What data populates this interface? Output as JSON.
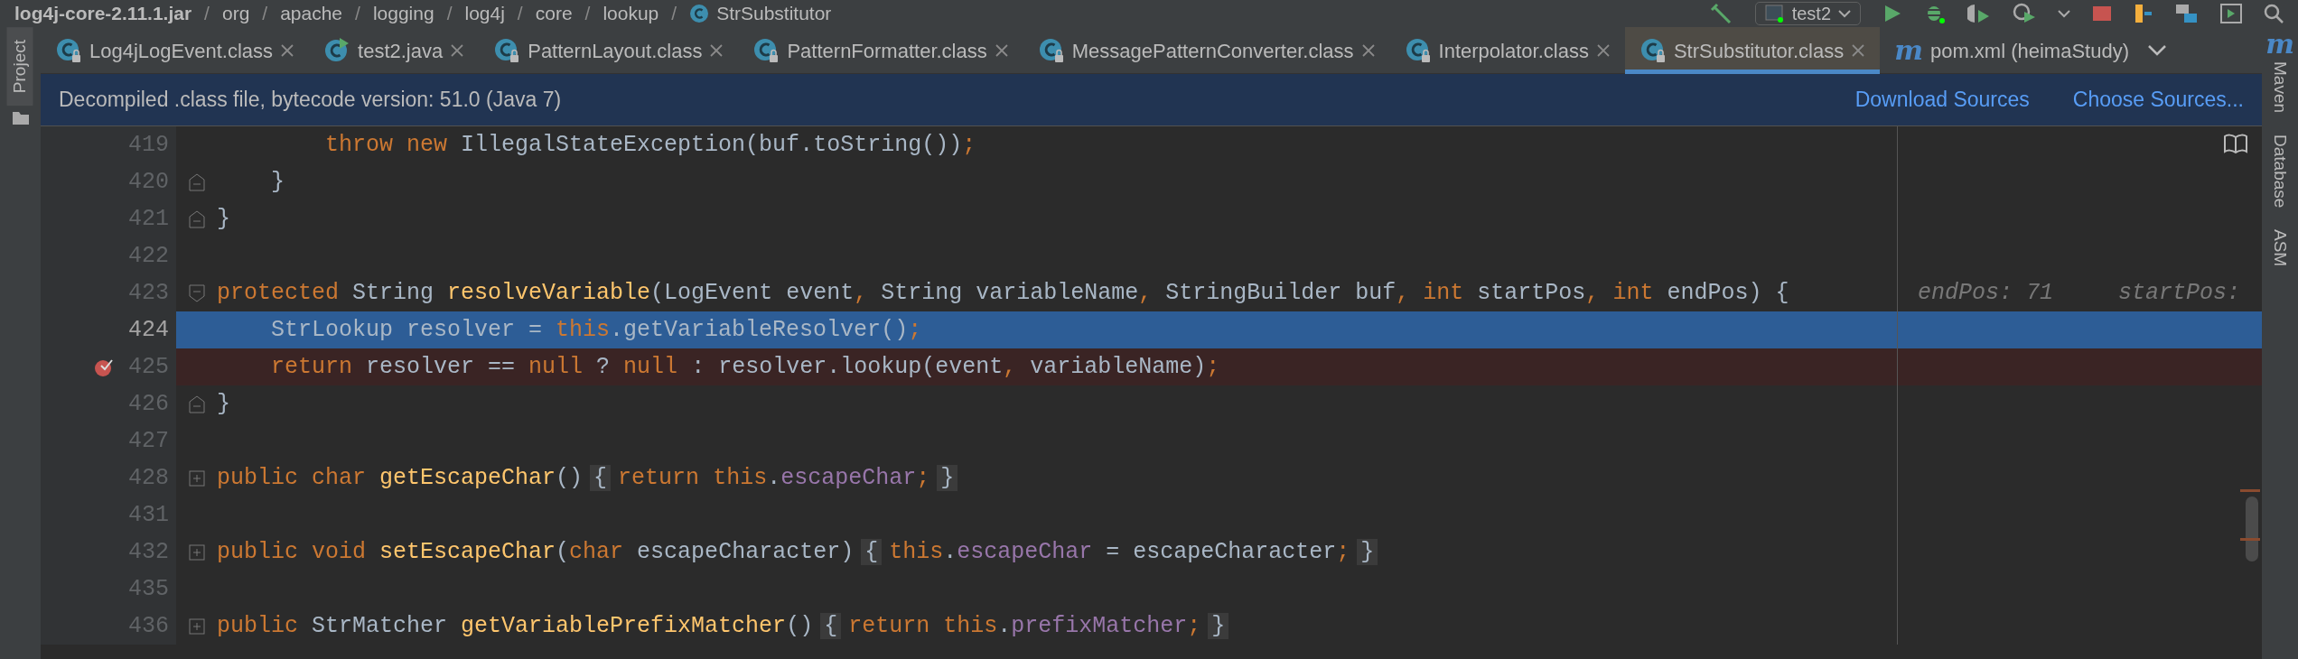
{
  "breadcrumb": {
    "separator": "/",
    "items": [
      "log4j-core-2.11.1.jar",
      "org",
      "apache",
      "logging",
      "log4j",
      "core",
      "lookup",
      "StrSubstitutor"
    ]
  },
  "run_config": {
    "label": "test2"
  },
  "tool_windows_left": [
    {
      "label": "Project",
      "selected": true
    }
  ],
  "tool_windows_right": [
    {
      "label": "Maven",
      "icon_text": "m"
    },
    {
      "label": "Database"
    },
    {
      "label": "ASM"
    }
  ],
  "tabs": [
    {
      "label": "Log4jLogEvent.class",
      "kind": "class",
      "selected": false
    },
    {
      "label": "test2.java",
      "kind": "java",
      "selected": false
    },
    {
      "label": "PatternLayout.class",
      "kind": "class",
      "selected": false
    },
    {
      "label": "PatternFormatter.class",
      "kind": "class",
      "selected": false
    },
    {
      "label": "MessagePatternConverter.class",
      "kind": "class",
      "selected": false
    },
    {
      "label": "Interpolator.class",
      "kind": "class",
      "selected": false
    },
    {
      "label": "StrSubstitutor.class",
      "kind": "class",
      "selected": true
    },
    {
      "label": "pom.xml (heimaStudy)",
      "kind": "maven",
      "icon_text": "m",
      "selected": false
    }
  ],
  "banner": {
    "text": "Decompiled .class file, bytecode version: 51.0 (Java 7)",
    "links": [
      "Download Sources",
      "Choose Sources..."
    ]
  },
  "lines": [
    {
      "number": "419",
      "kind": "plain",
      "current": false,
      "breakpoint": false,
      "tokens": [
        {
          "kind": "kw",
          "text": "        throw"
        },
        {
          "kind": "kw",
          "text": " new"
        },
        {
          "kind": "plain",
          "text": " IllegalStateException(buf.toString())"
        },
        {
          "kind": "punct",
          "text": ";"
        }
      ]
    },
    {
      "number": "420",
      "kind": "foldend",
      "current": false,
      "breakpoint": false,
      "tokens": [
        {
          "kind": "plain",
          "text": "    }"
        }
      ]
    },
    {
      "number": "421",
      "kind": "foldend",
      "current": false,
      "breakpoint": false,
      "tokens": [
        {
          "kind": "plain",
          "text": "}"
        }
      ]
    },
    {
      "number": "422",
      "kind": "plain",
      "current": false,
      "breakpoint": false
    },
    {
      "number": "423",
      "kind": "foldstart",
      "current": false,
      "breakpoint": false,
      "tokens": [
        {
          "kind": "kw",
          "text": "protected"
        },
        {
          "kind": "plain",
          "text": " String "
        },
        {
          "kind": "method",
          "text": "resolveVariable"
        },
        {
          "kind": "plain",
          "text": "(LogEvent event"
        },
        {
          "kind": "punct",
          "text": ","
        },
        {
          "kind": "plain",
          "text": " String variableName"
        },
        {
          "kind": "punct",
          "text": ","
        },
        {
          "kind": "plain",
          "text": " StringBuilder buf"
        },
        {
          "kind": "punct",
          "text": ","
        },
        {
          "kind": "kw",
          "text": " int"
        },
        {
          "kind": "plain",
          "text": " startPos"
        },
        {
          "kind": "punct",
          "text": ","
        },
        {
          "kind": "kw",
          "text": " int"
        },
        {
          "kind": "plain",
          "text": " endPos) {"
        }
      ],
      "hints": [
        "endPos: 71",
        "startPos:"
      ]
    },
    {
      "number": "424",
      "kind": "plain",
      "current": true,
      "breakpoint": false,
      "tokens": [
        {
          "kind": "plain",
          "text": "    StrLookup resolver = "
        },
        {
          "kind": "kw",
          "text": "this"
        },
        {
          "kind": "plain",
          "text": ".getVariableResolver()"
        },
        {
          "kind": "punct",
          "text": ";"
        }
      ]
    },
    {
      "number": "425",
      "kind": "plain",
      "current": false,
      "breakpoint": true,
      "tokens": [
        {
          "kind": "kw",
          "text": "    return"
        },
        {
          "kind": "plain",
          "text": " resolver == "
        },
        {
          "kind": "kw",
          "text": "null"
        },
        {
          "kind": "plain",
          "text": " ? "
        },
        {
          "kind": "kw",
          "text": "null"
        },
        {
          "kind": "plain",
          "text": " : resolver.lookup(event"
        },
        {
          "kind": "punct",
          "text": ","
        },
        {
          "kind": "plain",
          "text": " variableName)"
        },
        {
          "kind": "punct",
          "text": ";"
        }
      ]
    },
    {
      "number": "426",
      "kind": "foldend",
      "current": false,
      "breakpoint": false,
      "tokens": [
        {
          "kind": "plain",
          "text": "}"
        }
      ]
    },
    {
      "number": "427",
      "kind": "plain",
      "current": false,
      "breakpoint": false
    },
    {
      "number": "428",
      "kind": "folded",
      "current": false,
      "breakpoint": false,
      "tokens": [
        {
          "kind": "kw",
          "text": "public char "
        },
        {
          "kind": "method",
          "text": "getEscapeChar"
        },
        {
          "kind": "plain",
          "text": "()"
        },
        {
          "kind": "fold",
          "text": "{"
        },
        {
          "kind": "kw",
          "text": "return this"
        },
        {
          "kind": "plain",
          "text": "."
        },
        {
          "kind": "field",
          "text": "escapeChar"
        },
        {
          "kind": "punct",
          "text": ";"
        },
        {
          "kind": "fold",
          "text": "}"
        }
      ]
    },
    {
      "number": "431",
      "kind": "plain",
      "current": false,
      "breakpoint": false
    },
    {
      "number": "432",
      "kind": "folded",
      "current": false,
      "breakpoint": false,
      "tokens": [
        {
          "kind": "kw",
          "text": "public void "
        },
        {
          "kind": "method",
          "text": "setEscapeChar"
        },
        {
          "kind": "plain",
          "text": "("
        },
        {
          "kind": "kw",
          "text": "char"
        },
        {
          "kind": "plain",
          "text": " escapeCharacter)"
        },
        {
          "kind": "fold",
          "text": "{"
        },
        {
          "kind": "kw",
          "text": "this"
        },
        {
          "kind": "plain",
          "text": "."
        },
        {
          "kind": "field",
          "text": "escapeChar"
        },
        {
          "kind": "plain",
          "text": " = escapeCharacter"
        },
        {
          "kind": "punct",
          "text": ";"
        },
        {
          "kind": "fold",
          "text": "}"
        }
      ]
    },
    {
      "number": "435",
      "kind": "plain",
      "current": false,
      "breakpoint": false
    },
    {
      "number": "436",
      "kind": "folded",
      "current": false,
      "breakpoint": false,
      "tokens": [
        {
          "kind": "kw",
          "text": "public "
        },
        {
          "kind": "plain",
          "text": "StrMatcher "
        },
        {
          "kind": "method",
          "text": "getVariablePrefixMatcher"
        },
        {
          "kind": "plain",
          "text": "()"
        },
        {
          "kind": "fold",
          "text": "{"
        },
        {
          "kind": "kw",
          "text": "return this"
        },
        {
          "kind": "plain",
          "text": "."
        },
        {
          "kind": "field",
          "text": "prefixMatcher"
        },
        {
          "kind": "punct",
          "text": ";"
        },
        {
          "kind": "fold",
          "text": "}"
        }
      ]
    }
  ]
}
